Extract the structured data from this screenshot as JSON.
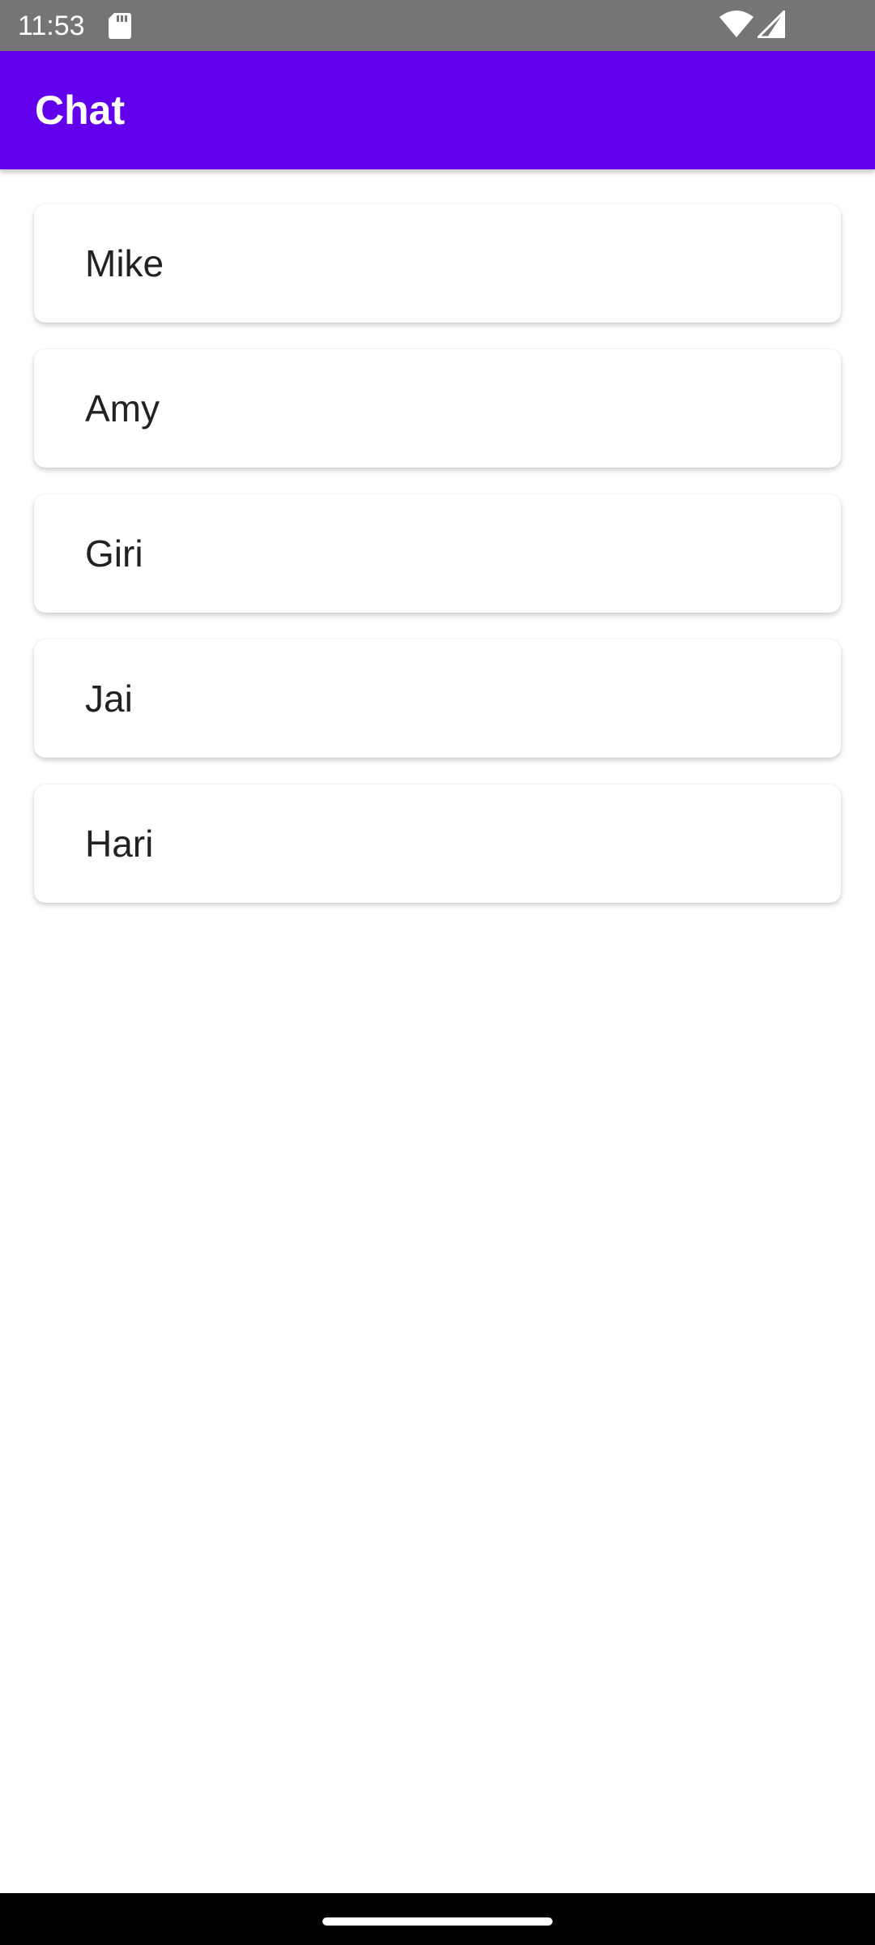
{
  "status_bar": {
    "time": "11:53",
    "icons": [
      "sd-card-icon",
      "wifi-icon",
      "signal-icon"
    ]
  },
  "app_bar": {
    "title": "Chat",
    "color": "#6200ee"
  },
  "chats": [
    {
      "name": "Mike"
    },
    {
      "name": "Amy"
    },
    {
      "name": "Giri"
    },
    {
      "name": "Jai"
    },
    {
      "name": "Hari"
    }
  ],
  "colors": {
    "status_bar": "#757575",
    "nav_bar": "#000000",
    "background": "#ffffff"
  }
}
